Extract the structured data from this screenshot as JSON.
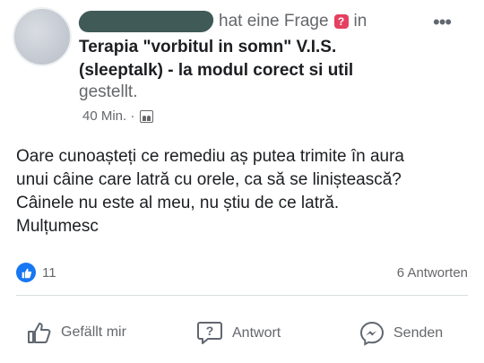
{
  "header": {
    "asked_text": "hat eine Frage",
    "in_text": "in",
    "group_name": "Terapia \"vorbitul in somn\" V.I.S. (sleeptalk) - la modul corect si util",
    "posted_text": "gestellt.",
    "time": "40 Min. ·",
    "more_label": "•••",
    "icons": [
      "question-badge-icon",
      "group-icon",
      "more-icon"
    ]
  },
  "post": {
    "lines": [
      "Oare cunoașteți ce remediu aș putea trimite în aura",
      "unui câine care latră cu orele, ca să se liniștească?",
      "Câinele nu este al meu, nu știu de ce latră.",
      "Mulțumesc"
    ]
  },
  "stats": {
    "reactions": "11",
    "answers": "6 Antworten"
  },
  "actions": {
    "like": "Gefällt mir",
    "answer": "Antwort",
    "send": "Senden"
  },
  "colors": {
    "accent": "#1877f2",
    "question_badge": "#e4405f",
    "muted_text": "#65676b"
  }
}
